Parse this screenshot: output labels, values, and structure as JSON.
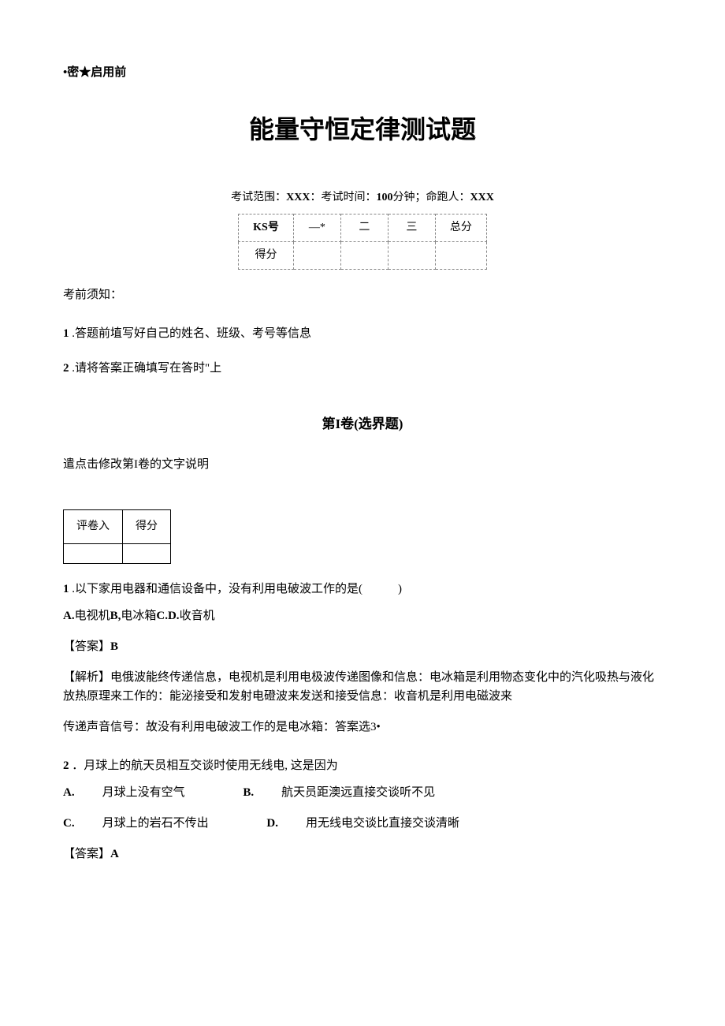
{
  "document": {
    "header_mark": "•密★启用前",
    "title": "能量守恒定律测试题",
    "exam_info_prefix": "考试范围：",
    "exam_info_xxx1": "XXX",
    "exam_info_colon1": "：考试时间：",
    "exam_info_time": "100",
    "exam_info_minutes": "分钟；命跑人：",
    "exam_info_xxx2": "XXX",
    "score_table": {
      "row1": [
        "KS号",
        "—*",
        "二",
        "三",
        "总分"
      ],
      "row2": [
        "得分",
        "",
        "",
        "",
        ""
      ]
    },
    "notice_title": "考前须知：",
    "notice_items": [
      {
        "num": "1",
        "text": ".答题前埴写好自己的姓名、班级、考号等信息"
      },
      {
        "num": "2",
        "text": ".请将答案正确填写在答时\"上"
      }
    ],
    "section1_title": "第I卷(选界题)",
    "section1_desc": "遣点击修改第I卷的文字说明",
    "grader_table": {
      "row1": [
        "评卷入",
        "得分"
      ],
      "row2": [
        "",
        ""
      ]
    },
    "q1": {
      "num": "1",
      "text": ".以下家用电器和通信设备中，没有利用电破波工作的是(　　　)",
      "options_prefix": "A.",
      "options_text": "电视机",
      "option_b": "B,",
      "option_b_text": "电冰箱",
      "option_cd": "C.D.",
      "option_cd_text": "收音机",
      "answer_label": "【答案】",
      "answer": "B",
      "explanation_label": "【解析】",
      "explanation_text": "电俄波能终传递信息，电视机是利用电极波传递图像和信息：电冰箱是利用物态变化中的汽化吸热与液化放热原理来工作的：能泌接受和发射电磴波来发送和接受信息：收音机是利用电磁波来",
      "sub_text": "传递声音信号：故没有利用电破波工作的是电冰箱：答案选3•"
    },
    "q2": {
      "num": "2",
      "text": "．月球上的航天员相互交谈时使用无线电, 这是因为",
      "option_a": "A.",
      "option_a_text": "月球上没有空气",
      "option_b": "B.",
      "option_b_text": "航天员距澳远直接交谈听不见",
      "option_c": "C.",
      "option_c_text": "月球上的岩石不传出",
      "option_d": "D.",
      "option_d_text": "用无线电交谈比直接交谈清晰",
      "answer_label": "【答案】",
      "answer": "A"
    }
  }
}
